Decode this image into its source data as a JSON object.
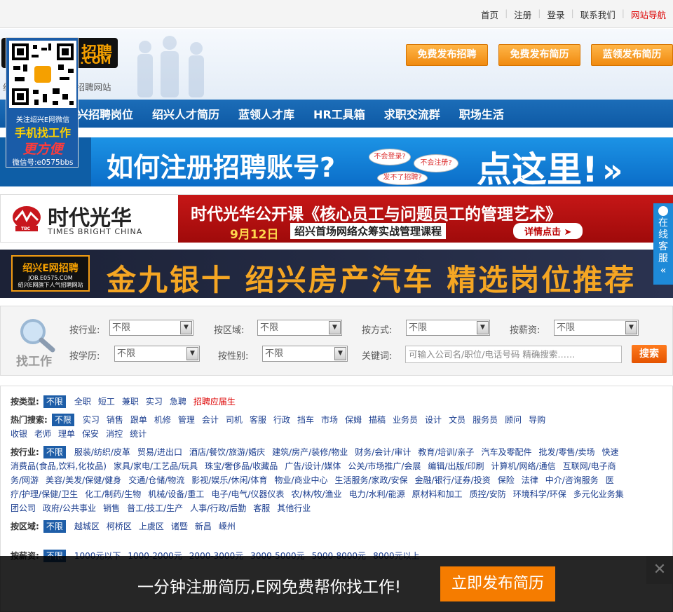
{
  "topnav": {
    "home": "首页",
    "register": "注册",
    "login": "登录",
    "contact": "联系我们",
    "sitemap": "网站导航"
  },
  "header": {
    "logo_text": "招聘",
    "logo_domain": ".COM",
    "logo_sub": "绍",
    "logo_sub2": "招聘网站",
    "buttons": [
      "免费发布招聘",
      "免费发布简历",
      "蓝领发布简历"
    ]
  },
  "mainnav": [
    "兴招聘岗位",
    "绍兴人才简历",
    "蓝领人才库",
    "HR工具箱",
    "求职交流群",
    "职场生活"
  ],
  "banner1": {
    "title": "如何注册招聘账号?",
    "bubble1": "不会登录?",
    "bubble2": "不会注册?",
    "bubble3": "发不了招聘?",
    "cta": "点这里!"
  },
  "banner2": {
    "brand": "时代光华",
    "brand_en": "TIMES BRIGHT CHINA",
    "brand_abbr": "TBC",
    "title": "时代光华公开课《核心员工与问题员工的管理艺术》",
    "date": "9月12日",
    "sub": "绍兴首场网络众筹实战管理课程",
    "btn": "详情点击 ➤"
  },
  "banner3": {
    "logo": "绍兴E网招聘",
    "logo_domain": "JOB.E0575.COM",
    "logo_sub": "绍兴E网旗下人气招聘网站",
    "title": "金九银十 绍兴房产汽车 精选岗位推荐"
  },
  "search": {
    "find_label": "找工作",
    "industry_label": "按行业:",
    "industry_value": "不限",
    "area_label": "按区域:",
    "area_value": "不限",
    "method_label": "按方式:",
    "method_value": "不限",
    "salary_label": "按薪资:",
    "salary_value": "不限",
    "edu_label": "按学历:",
    "edu_value": "不限",
    "gender_label": "按性别:",
    "gender_value": "不限",
    "keyword_label": "关键词:",
    "keyword_placeholder": "可输入公司名/职位/电话号码 精确搜索……",
    "button": "搜索"
  },
  "filters": {
    "type": {
      "label": "按类型:",
      "active": "不限",
      "items": [
        "全职",
        "短工",
        "兼职",
        "实习",
        "急聘"
      ],
      "special": "招聘应届生"
    },
    "hot": {
      "label": "热门搜索:",
      "active": "不限",
      "items": [
        "实习",
        "销售",
        "跟单",
        "机修",
        "管理",
        "会计",
        "司机",
        "客服",
        "行政",
        "挡车",
        "市场",
        "保姆",
        "描稿",
        "业务员",
        "设计",
        "文员",
        "服务员",
        "顾问",
        "导购"
      ],
      "items2": [
        "收银",
        "老师",
        "理单",
        "保安",
        "消控",
        "统计"
      ]
    },
    "industry": {
      "label": "按行业:",
      "active": "不限",
      "lines": [
        [
          "服装/纺织/皮革",
          "贸易/进出口",
          "酒店/餐饮/旅游/婚庆",
          "建筑/房产/装修/物业",
          "财务/会计/审计",
          "教育/培训/亲子",
          "汽车及零配件",
          "批发/零售/卖场",
          "快速"
        ],
        [
          "消费品(食品,饮料,化妆品)",
          "家具/家电/工艺品/玩具",
          "珠宝/奢侈品/收藏品",
          "广告/设计/媒体",
          "公关/市场推广/会展",
          "编辑/出版/印刷",
          "计算机/网络/通信",
          "互联网/电子商"
        ],
        [
          "务/网游",
          "美容/美发/保健/健身",
          "交通/仓储/物流",
          "影视/娱乐/休闲/体育",
          "物业/商业中心",
          "生活服务/家政/安保",
          "金融/银行/证券/投资",
          "保险",
          "法律",
          "中介/咨询服务",
          "医"
        ],
        [
          "疗/护理/保健/卫生",
          "化工/制药/生物",
          "机械/设备/重工",
          "电子/电气/仪器仪表",
          "农/林/牧/渔业",
          "电力/水利/能源",
          "原材料和加工",
          "质控/安防",
          "环境科学/环保",
          "多元化业务集"
        ],
        [
          "团公司",
          "政府/公共事业",
          "销售",
          "普工/技工/生产",
          "人事/行政/后勤",
          "客服",
          "其他行业"
        ]
      ]
    },
    "area": {
      "label": "按区域:",
      "active": "不限",
      "items": [
        "越城区",
        "柯桥区",
        "上虞区",
        "诸暨",
        "新昌",
        "嵊州"
      ]
    },
    "salary": {
      "label": "按薪资:",
      "active": "不限",
      "items": [
        "1000元以下",
        "1000-2000元",
        "2000-3000元",
        "3000-5000元",
        "5000-8000元",
        "8000元以上"
      ]
    }
  },
  "qr": {
    "line1": "关注绍兴E网微信",
    "line2": "手机找工作",
    "line3": "更方便",
    "line4": "微信号:e0575bbs"
  },
  "kefu": {
    "label": "在线客服",
    "arrow": "«"
  },
  "bottombar": {
    "text": "一分钟注册简历,E网免费帮你找工作!",
    "button": "立即发布简历",
    "close": "✕"
  }
}
